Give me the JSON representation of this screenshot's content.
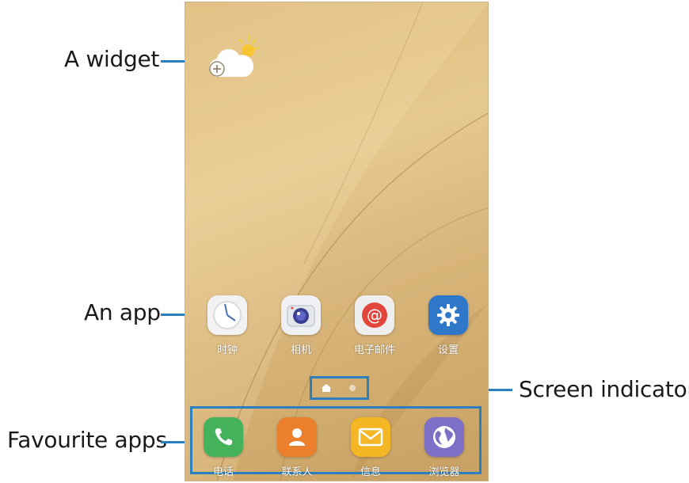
{
  "callouts": {
    "widget": "A widget",
    "app": "An app",
    "screen_indicators": "Screen indicators",
    "favourite_apps": "Favourite apps"
  },
  "home_apps": [
    {
      "label": "时钟",
      "icon": "clock-icon"
    },
    {
      "label": "相机",
      "icon": "camera-icon"
    },
    {
      "label": "电子邮件",
      "icon": "email-icon"
    },
    {
      "label": "设置",
      "icon": "gear-icon"
    }
  ],
  "favourite_apps": [
    {
      "label": "电话",
      "icon": "phone-icon"
    },
    {
      "label": "联系人",
      "icon": "contacts-icon"
    },
    {
      "label": "信息",
      "icon": "message-icon"
    },
    {
      "label": "浏览器",
      "icon": "browser-icon"
    }
  ],
  "colors": {
    "accent": "#2a7fbf",
    "wallpaper": "#dcb97a"
  }
}
